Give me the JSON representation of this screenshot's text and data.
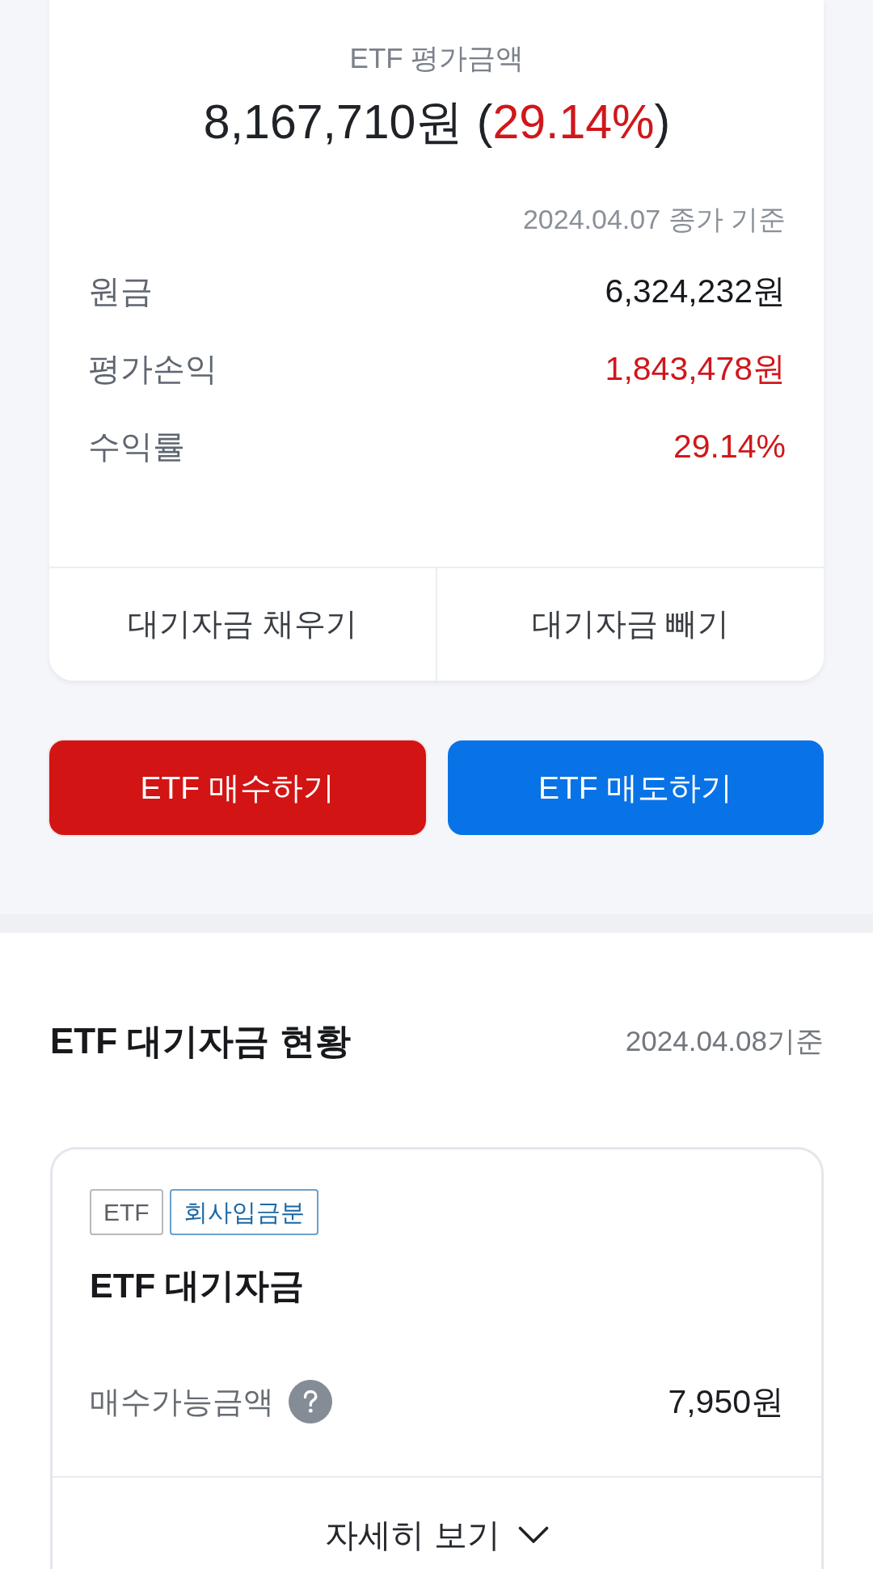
{
  "valuation": {
    "title": "ETF 평가금액",
    "headline": [
      {
        "text": "8,167,710원 (",
        "color": "#1f2328"
      },
      {
        "text": "29.14%",
        "color": "#d0171b"
      },
      {
        "text": ")",
        "color": "#1f2328"
      }
    ],
    "as_of": "2024.04.07 종가 기준",
    "rows": [
      {
        "label": "원금",
        "value": "6,324,232원",
        "color": "#16191d"
      },
      {
        "label": "평가손익",
        "value": "1,843,478원",
        "color": "#d0171b"
      },
      {
        "label": "수익률",
        "value": "29.14%",
        "color": "#d0171b"
      }
    ],
    "actions": [
      "대기자금 채우기",
      "대기자금 빼기"
    ]
  },
  "trade_buttons": [
    {
      "label": "ETF 매수하기",
      "kind": "buy"
    },
    {
      "label": "ETF 매도하기",
      "kind": "sell"
    }
  ],
  "cash_section": {
    "title": "ETF 대기자금 현황",
    "as_of": "2024.04.08기준",
    "card": {
      "tags": [
        {
          "label": "ETF",
          "kind": "plain"
        },
        {
          "label": "회사입금분",
          "kind": "accent"
        }
      ],
      "title": "ETF 대기자금",
      "rows": [
        {
          "label": "매수가능금액",
          "help": true,
          "value": "7,950원"
        }
      ],
      "details": {
        "label": "자세히 보기",
        "expanded": false
      }
    }
  }
}
